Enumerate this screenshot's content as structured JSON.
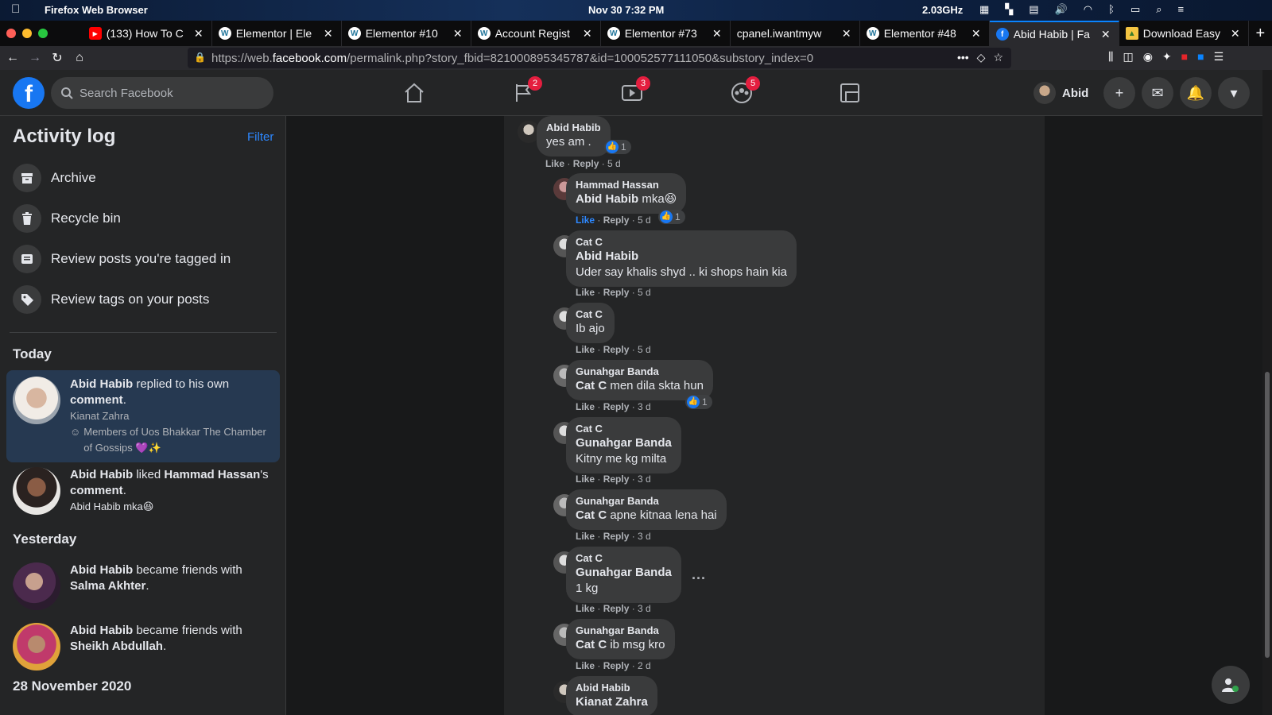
{
  "menubar": {
    "app_name": "Firefox Web Browser",
    "clock": "Nov 30   7:32 PM",
    "cpu": "2.03GHz"
  },
  "browser": {
    "tabs": [
      {
        "title": "(133) How To C",
        "favicon": "youtube-icon",
        "color": "#ff0000"
      },
      {
        "title": "Elementor | Ele",
        "favicon": "wordpress-icon",
        "color": "#ffffff"
      },
      {
        "title": "Elementor #10",
        "favicon": "wordpress-icon",
        "color": "#ffffff"
      },
      {
        "title": "Account Regist",
        "favicon": "wordpress-icon",
        "color": "#ffffff"
      },
      {
        "title": "Elementor #73",
        "favicon": "wordpress-icon",
        "color": "#ffffff"
      },
      {
        "title": "cpanel.iwantmyw",
        "favicon": "none",
        "color": ""
      },
      {
        "title": "Elementor #48",
        "favicon": "wordpress-icon",
        "color": "#ffffff"
      },
      {
        "title": "Abid Habib | Fa",
        "favicon": "facebook-icon",
        "color": "#1877f2",
        "active": true
      },
      {
        "title": "Download Easy",
        "favicon": "image-icon",
        "color": "#f5c542"
      }
    ],
    "url_prefix": "https://web.",
    "url_host": "facebook.com",
    "url_path": "/permalink.php?story_fbid=821000895345787&id=100052577111050&substory_index=0"
  },
  "fb": {
    "search_placeholder": "Search Facebook",
    "nav_badges": {
      "pages": "2",
      "watch": "3",
      "groups": "5"
    },
    "profile_name": "Abid",
    "accent": "#1877f2"
  },
  "sidebar": {
    "title": "Activity log",
    "filter": "Filter",
    "menu": [
      {
        "label": "Archive",
        "icon": "archive-icon"
      },
      {
        "label": "Recycle bin",
        "icon": "trash-icon"
      },
      {
        "label": "Review posts you're tagged in",
        "icon": "tagged-posts-icon"
      },
      {
        "label": "Review tags on your posts",
        "icon": "tag-icon"
      }
    ],
    "today_label": "Today",
    "yesterday_label": "Yesterday",
    "older_label": "28 November 2020",
    "entries": [
      {
        "actor": "Abid Habib",
        "pre": " replied to his own ",
        "object": "comment",
        "post": ".",
        "line2": "Kianat Zahra",
        "line3": "Members of Uos Bhakkar The Chamber of Gossips 💜✨"
      },
      {
        "actor": "Abid Habib",
        "pre": " liked ",
        "object": "Hammad Hassan",
        "post": "'s",
        "object2": "comment",
        "post2": ".",
        "line2": "Abid Habib mka😆"
      },
      {
        "actor": "Abid Habib",
        "pre": " became friends with",
        "object": "Salma Akhter",
        "post": "."
      },
      {
        "actor": "Abid Habib",
        "pre": " became friends with",
        "object": "Sheikh Abdullah",
        "post": "."
      }
    ]
  },
  "comments": [
    {
      "author": "Abid Habib",
      "mention": "",
      "text": "yes am .",
      "like": "Like",
      "reply": "Reply",
      "time": "5 d",
      "reactions": "1"
    },
    {
      "author": "Hammad Hassan",
      "mention": "Abid Habib",
      "text": " mka😆",
      "like": "Like",
      "reply": "Reply",
      "time": "5 d",
      "reactions": "1"
    },
    {
      "author": "Cat C",
      "mention": "Abid Habib",
      "text": "Uder say khalis shyd .. ki shops hain kia",
      "like": "Like",
      "reply": "Reply",
      "time": "5 d"
    },
    {
      "author": "Cat C",
      "mention": "",
      "text": "Ib ajo",
      "like": "Like",
      "reply": "Reply",
      "time": "5 d"
    },
    {
      "author": "Gunahgar Banda",
      "mention": "Cat C",
      "text": " men dila skta hun",
      "like": "Like",
      "reply": "Reply",
      "time": "3 d",
      "reactions": "1"
    },
    {
      "author": "Cat C",
      "mention": "Gunahgar Banda",
      "text": "Kitny me kg milta",
      "like": "Like",
      "reply": "Reply",
      "time": "3 d"
    },
    {
      "author": "Gunahgar Banda",
      "mention": "Cat C",
      "text": " apne kitnaa lena hai",
      "like": "Like",
      "reply": "Reply",
      "time": "3 d"
    },
    {
      "author": "Cat C",
      "mention": "Gunahgar Banda",
      "text": "1 kg",
      "like": "Like",
      "reply": "Reply",
      "time": "3 d"
    },
    {
      "author": "Gunahgar Banda",
      "mention": "Cat C",
      "text": " ib msg kro",
      "like": "Like",
      "reply": "Reply",
      "time": "2 d"
    },
    {
      "author": "Abid Habib",
      "mention": "Kianat Zahra",
      "text": ""
    }
  ]
}
